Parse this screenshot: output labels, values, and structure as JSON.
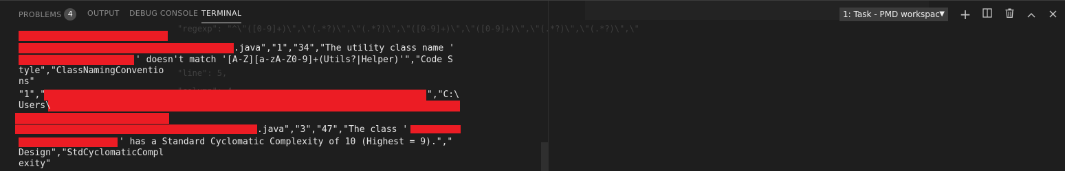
{
  "tabs": [
    {
      "label": "PROBLEMS",
      "badge": "4",
      "active": false
    },
    {
      "label": "OUTPUT",
      "active": false
    },
    {
      "label": "DEBUG CONSOLE",
      "active": false
    },
    {
      "label": "TERMINAL",
      "active": true
    }
  ],
  "terminal_select": {
    "value": "1: Task - PMD workspac",
    "caret": "▼"
  },
  "actions": {
    "new_terminal": "+",
    "split": "▥",
    "kill": "🗑",
    "maximize": "︿",
    "close": "✕"
  },
  "ghost_text": {
    "regexp": "\"regexp\": \"^\\\"([0-9]+)\\\",\\\"(.*?)\\\",\\\"(.*?)\\\",\\\"([0-9]+)\\\",\\\"([0-9]+)\\\",\\\"(.*?)\\\",\\\"(.*?)\\\",\\\"",
    "line": "\"line\": 5,",
    "column": "\"column\": 4,"
  },
  "terminal_lines": [
    ".java\",\"1\",\"34\",\"The utility class name '",
    "' doesn't match '[A-Z][a-zA-Z0-9]+(Utils?|Helper)'\",\"Code S",
    "tyle\",\"ClassNamingConventio",
    "ns\"",
    "\"1\",\"",
    "\",\"C:\\",
    "Users\\",
    ".java\",\"3\",\"47\",\"The class '",
    "' has a Standard Cyclomatic Complexity of 10 (Highest = 9).\",\"",
    "Design\",\"StdCyclomaticCompl",
    "exity\""
  ],
  "colors": {
    "background": "#1e1e1e",
    "redaction": "#ec1c24",
    "text": "#e6e6e6",
    "tab_inactive": "#8b8b8b"
  }
}
